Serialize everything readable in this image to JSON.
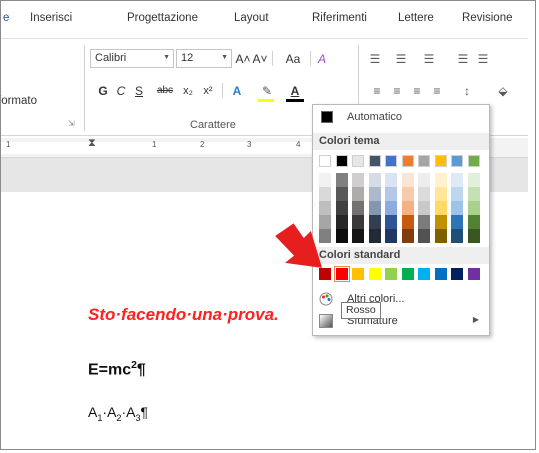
{
  "ribbon_tabs": [
    "Inserisci",
    "Progettazione",
    "Layout",
    "Riferimenti",
    "Lettere",
    "Revisione"
  ],
  "clipboard": {
    "format_label": "formato"
  },
  "font": {
    "name_value": "Calibri",
    "size_value": "12",
    "bold": "G",
    "italic": "C",
    "underline": "S",
    "strike": "abc",
    "subscript": "x₂",
    "superscript": "x²",
    "grow": "A˄",
    "shrink": "A˅",
    "case": "Aa",
    "clear": "A",
    "group_label": "Carattere"
  },
  "ruler": {
    "marks": [
      "1",
      "1",
      "2",
      "3",
      "4"
    ]
  },
  "document": {
    "line1": "Sto·facendo·una·prova.",
    "line2_main": "E=mc",
    "line2_sup": "2",
    "line2_end": "¶",
    "line3_a": "A",
    "line3_s1": "1",
    "line3_b": "·A",
    "line3_s2": "2",
    "line3_c": "·A",
    "line3_s3": "3",
    "line3_end": "¶"
  },
  "color_menu": {
    "automatic_label": "Automatico",
    "theme_header": "Colori tema",
    "standard_header": "Colori standard",
    "more_colors_label": "Altri colori...",
    "gradients_label": "Sfumature",
    "tooltip": "Rosso",
    "theme_top": [
      "#ffffff",
      "#000000",
      "#e7e6e6",
      "#44546a",
      "#4472c4",
      "#ed7d31",
      "#a5a5a5",
      "#ffc000",
      "#5b9bd5",
      "#70ad47"
    ],
    "theme_columns": [
      [
        "#f2f2f2",
        "#d9d9d9",
        "#bfbfbf",
        "#a6a6a6",
        "#808080"
      ],
      [
        "#808080",
        "#595959",
        "#404040",
        "#262626",
        "#0d0d0d"
      ],
      [
        "#d0cece",
        "#aeabab",
        "#757171",
        "#3a3838",
        "#171616"
      ],
      [
        "#d6dce5",
        "#adb9ca",
        "#8497b0",
        "#333f50",
        "#222a35"
      ],
      [
        "#dae3f3",
        "#b4c7e7",
        "#8faadc",
        "#2f5597",
        "#203864"
      ],
      [
        "#fbe5d6",
        "#f8cbad",
        "#f4b183",
        "#c55a11",
        "#843c0c"
      ],
      [
        "#ededed",
        "#dbdbdb",
        "#c9c9c9",
        "#7b7b7b",
        "#525252"
      ],
      [
        "#fff2cc",
        "#ffe699",
        "#ffd966",
        "#bf9000",
        "#7f6000"
      ],
      [
        "#deebf7",
        "#bdd7ee",
        "#9dc3e6",
        "#2e75b6",
        "#1f4e79"
      ],
      [
        "#e2f0d9",
        "#c5e0b4",
        "#a9d18e",
        "#548235",
        "#385723"
      ]
    ],
    "standard": [
      "#c00000",
      "#ff0000",
      "#ffc000",
      "#ffff00",
      "#92d050",
      "#00b050",
      "#00b0f0",
      "#0070c0",
      "#002060",
      "#7030a0"
    ]
  }
}
